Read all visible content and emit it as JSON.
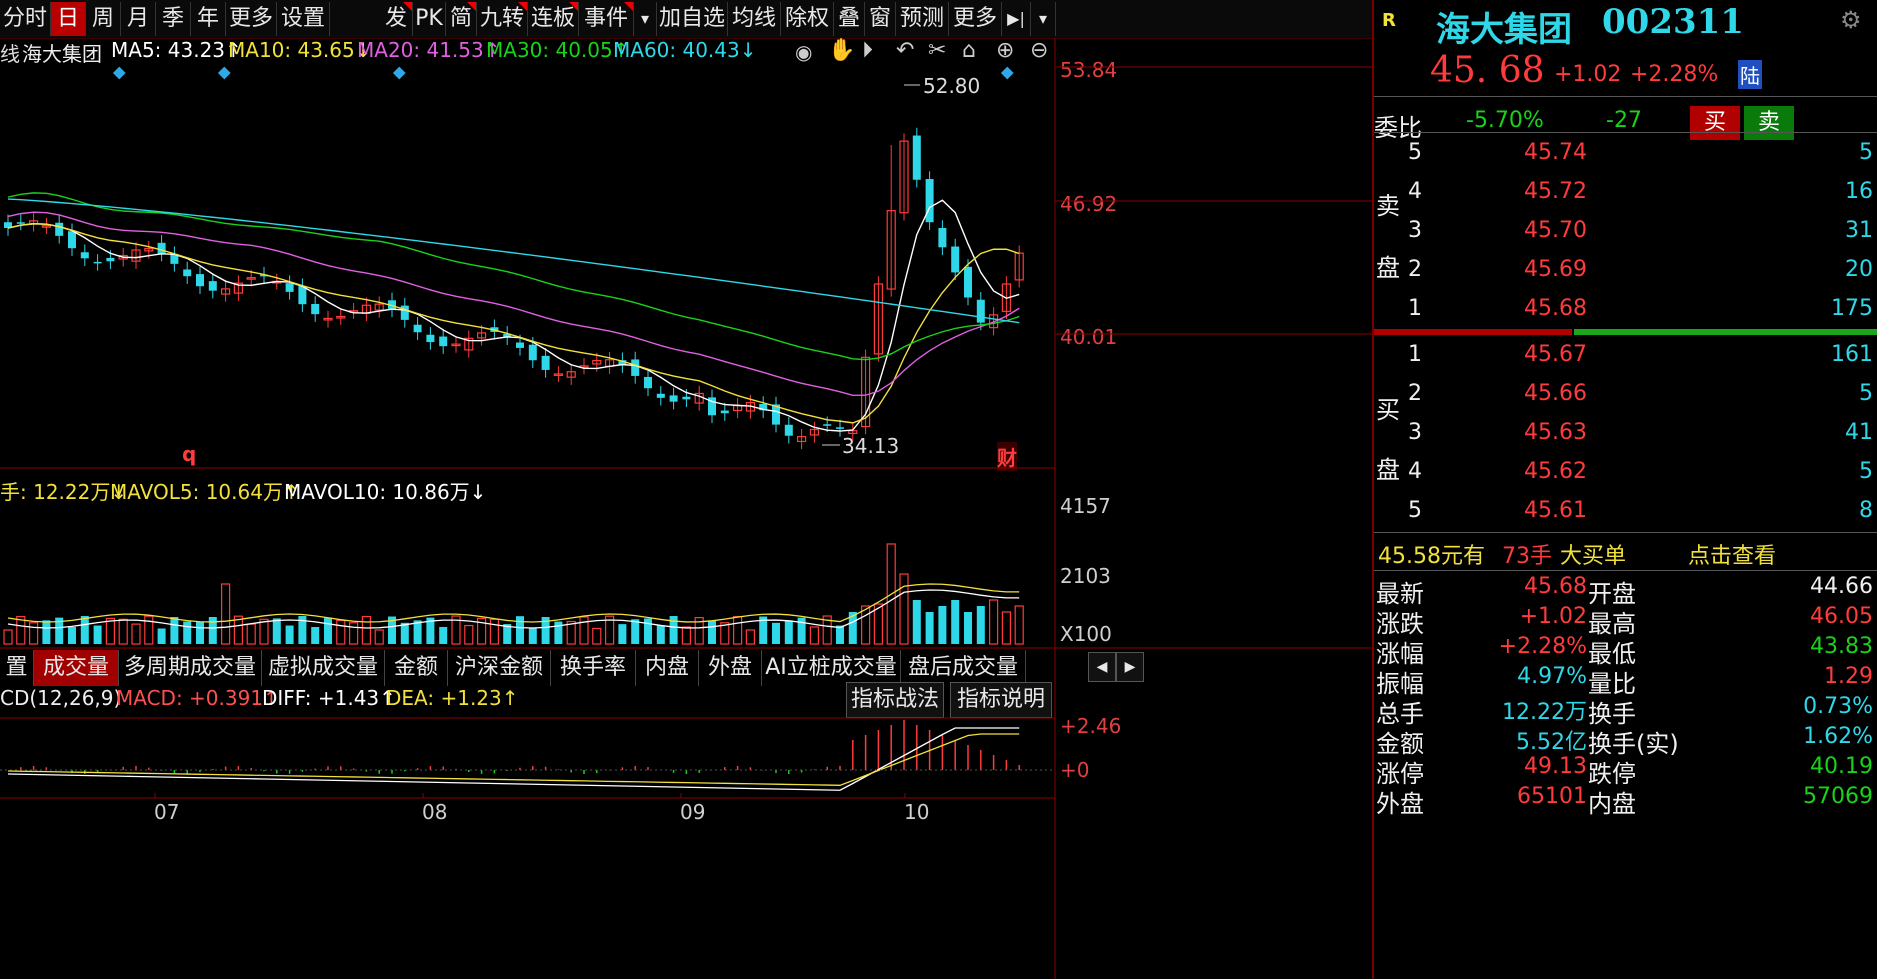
{
  "toolbar": {
    "left": [
      "分时",
      "日",
      "周",
      "月",
      "季",
      "年",
      "更多",
      "设置"
    ],
    "right": [
      "发",
      "PK",
      "简",
      "九转",
      "连板",
      "事件",
      "▾",
      "加自选",
      "均线",
      "除权",
      "叠",
      "窗",
      "预测",
      "更多",
      "▶|",
      "▾"
    ]
  },
  "ma_line": {
    "prefix": "线",
    "name": "海大集团",
    "ma5": "MA5: 43.23↑",
    "ma10": "MA10: 43.65↓",
    "ma20": "MA20: 41.53↑",
    "ma30": "MA30: 40.05↑",
    "ma60": "MA60: 40.43↓"
  },
  "price_axis": [
    "53.84",
    "46.92",
    "40.01"
  ],
  "annotations": {
    "high": "52.80",
    "low": "34.13",
    "q_mark": "q",
    "cai_mark": "财"
  },
  "vol_line": {
    "vol": "手: 12.22万↓",
    "mavol5": "MAVOL5: 10.64万↑",
    "mavol10": "MAVOL10: 10.86万↓"
  },
  "vol_axis": [
    "4157",
    "2103",
    "X100"
  ],
  "tabs": [
    "置",
    "成交量",
    "多周期成交量",
    "虚拟成交量",
    "金额",
    "沪深金额",
    "换手率",
    "内盘",
    "外盘",
    "AI立桩成交量",
    "盘后成交量"
  ],
  "macd_line": {
    "name": "CD(12,26,9)",
    "macd": "MACD: +0.391↑",
    "diff": "DIFF: +1.43↑",
    "dea": "DEA: +1.23↑"
  },
  "macd_buttons": [
    "指标战法",
    "指标说明"
  ],
  "macd_axis": [
    "+2.46",
    "+0"
  ],
  "months": [
    "07",
    "08",
    "09",
    "10"
  ],
  "colors": {
    "up": "#ff3b3b",
    "down": "#2fd8e8",
    "ma5": "#ffffff",
    "ma10": "#f2e13a",
    "ma20": "#e060e0",
    "ma30": "#19d219",
    "ma60": "#2fd8e8"
  },
  "quote": {
    "r_badge": "R",
    "name": "海大集团",
    "code": "002311",
    "price": "45. 68",
    "change": "+1.02",
    "pct": "+2.28%",
    "lu": "陆",
    "weibi_label": "委比",
    "weibi_pct": "-5.70%",
    "weibi_diff": "-27",
    "buy_btn": "买",
    "sell_btn": "卖",
    "sell_label": [
      "卖",
      "盘"
    ],
    "buy_label": [
      "买",
      "盘"
    ],
    "asks": [
      {
        "lvl": "5",
        "price": "45.74",
        "vol": "5"
      },
      {
        "lvl": "4",
        "price": "45.72",
        "vol": "16"
      },
      {
        "lvl": "3",
        "price": "45.70",
        "vol": "31"
      },
      {
        "lvl": "2",
        "price": "45.69",
        "vol": "20"
      },
      {
        "lvl": "1",
        "price": "45.68",
        "vol": "175"
      }
    ],
    "bids": [
      {
        "lvl": "1",
        "price": "45.67",
        "vol": "161"
      },
      {
        "lvl": "2",
        "price": "45.66",
        "vol": "5"
      },
      {
        "lvl": "3",
        "price": "45.63",
        "vol": "41"
      },
      {
        "lvl": "4",
        "price": "45.62",
        "vol": "5"
      },
      {
        "lvl": "5",
        "price": "45.61",
        "vol": "8"
      }
    ],
    "bigorder": {
      "price": "45.58元有",
      "qty": "73手",
      "text": "大买单",
      "link": "点击查看"
    },
    "stats": [
      {
        "l1": "最新",
        "v1": "45.68",
        "l2": "开盘",
        "v2": "44.66",
        "c1": "red",
        "c2": "white"
      },
      {
        "l1": "涨跌",
        "v1": "+1.02",
        "l2": "最高",
        "v2": "46.05",
        "c1": "red",
        "c2": "red"
      },
      {
        "l1": "涨幅",
        "v1": "+2.28%",
        "l2": "最低",
        "v2": "43.83",
        "c1": "red",
        "c2": "green"
      },
      {
        "l1": "振幅",
        "v1": "4.97%",
        "l2": "量比",
        "v2": "1.29",
        "c1": "cyan",
        "c2": "red"
      },
      {
        "l1": "总手",
        "v1": "12.22万",
        "l2": "换手",
        "v2": "0.73%",
        "c1": "cyan",
        "c2": "cyan"
      },
      {
        "l1": "金额",
        "v1": "5.52亿",
        "l2": "换手(实)",
        "v2": "1.62%",
        "c1": "cyan",
        "c2": "cyan"
      },
      {
        "l1": "涨停",
        "v1": "49.13",
        "l2": "跌停",
        "v2": "40.19",
        "c1": "red",
        "c2": "green"
      },
      {
        "l1": "外盘",
        "v1": "65101",
        "l2": "内盘",
        "v2": "57069",
        "c1": "red",
        "c2": "green"
      }
    ]
  }
}
